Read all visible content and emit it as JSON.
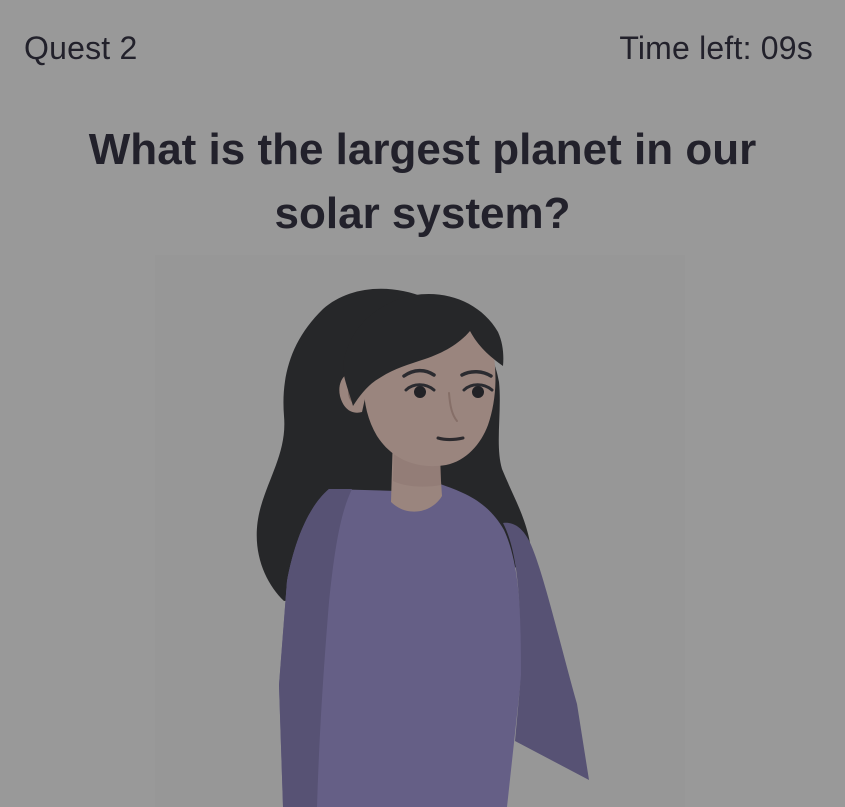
{
  "header": {
    "quest_label": "Quest 2",
    "timer_label": "Time left: 09s"
  },
  "question": {
    "text": "What is the largest planet in our solar system?"
  },
  "character": {
    "name": "girl-character",
    "colors": {
      "hair": "#262729",
      "skin": "#9a857e",
      "shirt": "#655f86",
      "shirt_shadow": "#575274",
      "background": "#999999"
    }
  }
}
